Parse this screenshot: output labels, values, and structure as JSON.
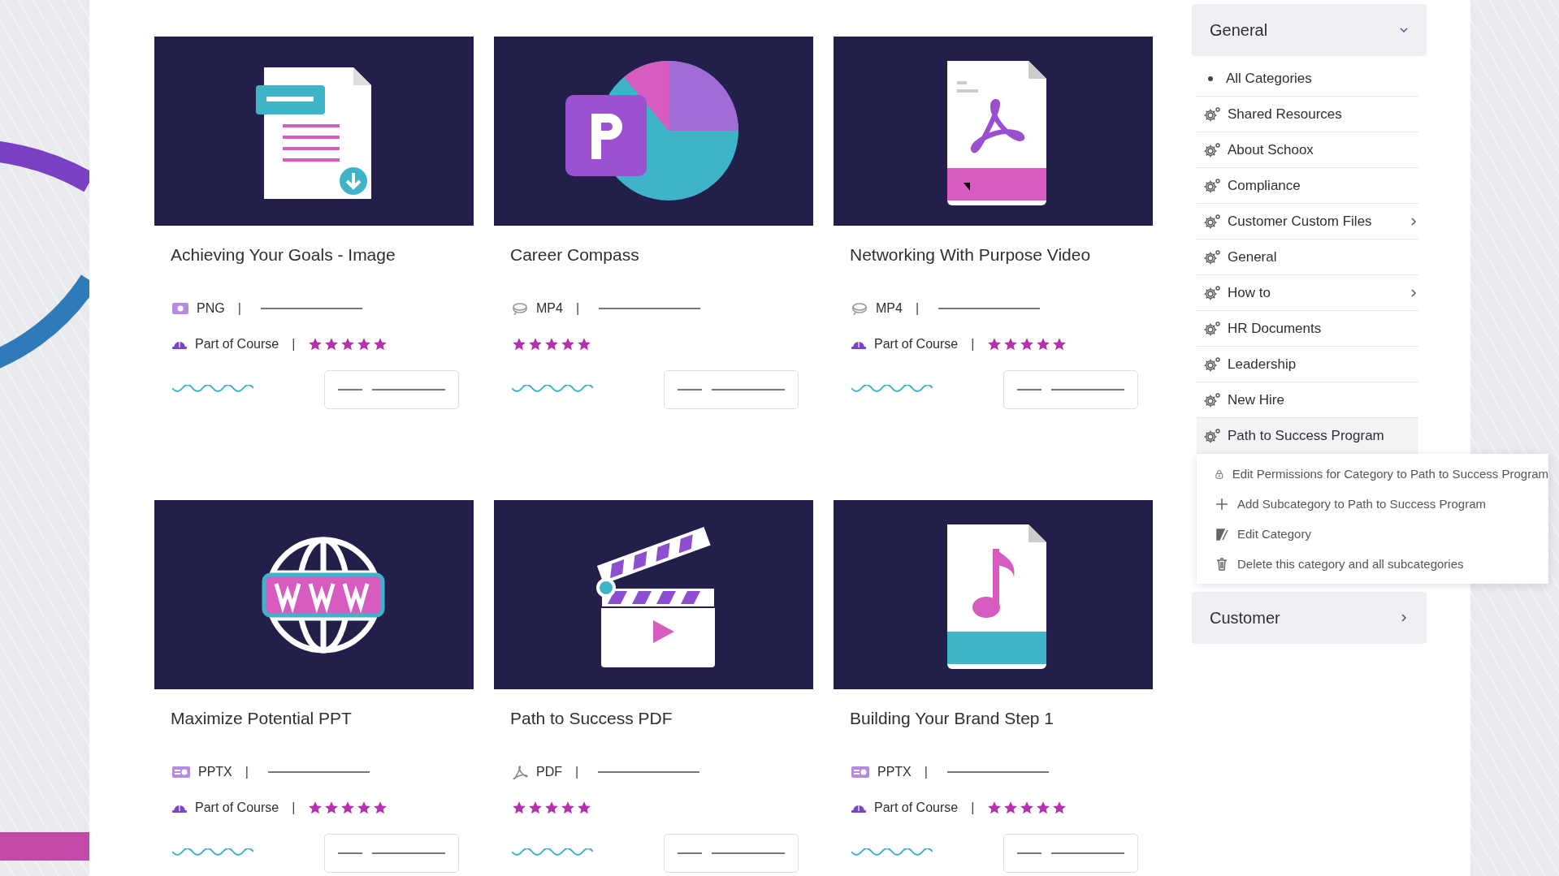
{
  "cards": [
    {
      "title": "Achieving Your Goals - Image",
      "kind": "document",
      "format": {
        "label": "PNG",
        "kind": "image"
      },
      "format_separator": "|",
      "course_label": "Part of Course",
      "course_separator": "|",
      "stars": 5
    },
    {
      "title": "Career Compass",
      "kind": "presentation",
      "format": {
        "label": "MP4",
        "kind": "video"
      },
      "format_separator": "|",
      "stars": 5
    },
    {
      "title": "Networking With Purpose Video",
      "kind": "pdf",
      "format": {
        "label": "MP4",
        "kind": "video"
      },
      "format_separator": "|",
      "course_label": "Part of Course",
      "course_separator": "|",
      "stars": 5
    },
    {
      "title": "Maximize Potential PPT",
      "kind": "web",
      "format": {
        "label": "PPTX",
        "kind": "slides"
      },
      "format_separator": "|",
      "course_label": "Part of Course",
      "course_separator": "|",
      "stars": 5
    },
    {
      "title": "Path to Success PDF",
      "kind": "video",
      "format": {
        "label": "PDF",
        "kind": "pdf"
      },
      "format_separator": "|",
      "stars": 5
    },
    {
      "title": "Building Your Brand Step 1",
      "kind": "audio",
      "format": {
        "label": "PPTX",
        "kind": "slides"
      },
      "format_separator": "|",
      "course_label": "Part of Course",
      "course_separator": "|",
      "stars": 5
    }
  ],
  "sidebar": {
    "header": {
      "label": "General",
      "expanded": true
    },
    "items": [
      {
        "label": "All Categories",
        "kind": "bullet",
        "has_children": false,
        "selected": false
      },
      {
        "label": "Shared Resources",
        "kind": "category",
        "has_children": false,
        "selected": false
      },
      {
        "label": "About Schoox",
        "kind": "category",
        "has_children": false,
        "selected": false
      },
      {
        "label": "Compliance",
        "kind": "category",
        "has_children": false,
        "selected": false
      },
      {
        "label": "Customer Custom Files",
        "kind": "category",
        "has_children": true,
        "selected": false
      },
      {
        "label": "General",
        "kind": "category",
        "has_children": false,
        "selected": false
      },
      {
        "label": "How to",
        "kind": "category",
        "has_children": true,
        "selected": false
      },
      {
        "label": "HR Documents",
        "kind": "category",
        "has_children": false,
        "selected": false
      },
      {
        "label": "Leadership",
        "kind": "category",
        "has_children": false,
        "selected": false
      },
      {
        "label": "New Hire",
        "kind": "category",
        "has_children": false,
        "selected": false
      },
      {
        "label": "Path to Success Program",
        "kind": "category",
        "has_children": false,
        "selected": true
      }
    ],
    "context_menu": [
      {
        "label": "Edit Permissions for Category to Path to Success Program",
        "kind": "lock"
      },
      {
        "label": "Add Subcategory to Path to Success Program",
        "kind": "plus"
      },
      {
        "label": "Edit Category",
        "kind": "edit"
      },
      {
        "label": "Delete this category and all subcategories",
        "kind": "trash"
      }
    ],
    "second_header": {
      "label": "Customer",
      "expanded": false
    }
  }
}
